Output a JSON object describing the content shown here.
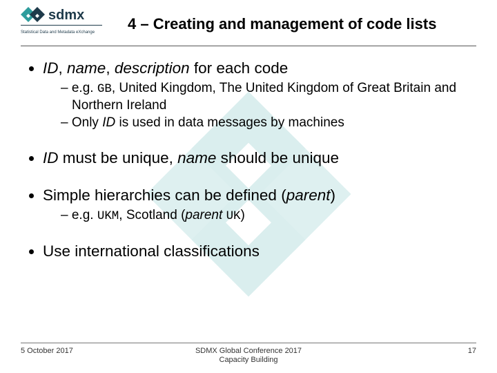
{
  "header": {
    "title": "4 – Creating and management of code lists",
    "logo": {
      "wordmark": "sdmx",
      "tagline": "Statistical Data and Metadata eXchange"
    }
  },
  "bullets": [
    {
      "html": "<span class=\"it\">ID</span>, <span class=\"it\">name</span>, <span class=\"it\">description</span> for each code",
      "sub": [
        {
          "html": "e.g. <span class=\"mono\">GB</span>, United Kingdom, The United Kingdom of Great Britain and Northern Ireland"
        },
        {
          "html": "Only <span class=\"it\">ID</span> is used in data messages by machines"
        }
      ]
    },
    {
      "html": "<span class=\"it\">ID</span> must be unique, <span class=\"it\">name</span> should be unique",
      "sub": []
    },
    {
      "html": "Simple hierarchies can be defined (<span class=\"it\">parent</span>)",
      "sub": [
        {
          "html": "e.g. <span class=\"mono\">UKM</span>, Scotland (<span class=\"it\">parent</span> <span class=\"mono\">UK</span>)"
        }
      ]
    },
    {
      "html": "Use international classifications",
      "sub": []
    }
  ],
  "footer": {
    "date": "5 October 2017",
    "center1": "SDMX Global Conference 2017",
    "center2": "Capacity Building",
    "page": "17"
  },
  "colors": {
    "brand_teal": "#2e9c9c",
    "brand_dark": "#1e3a4a"
  }
}
